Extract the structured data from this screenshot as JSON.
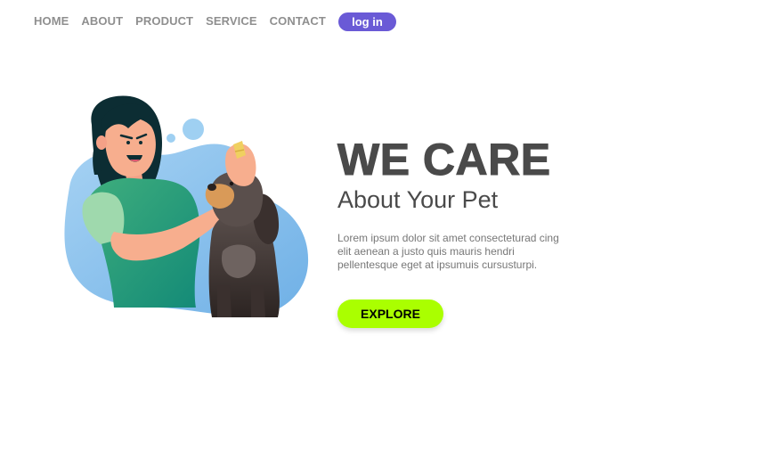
{
  "nav": {
    "items": [
      {
        "label": "HOME"
      },
      {
        "label": "ABOUT"
      },
      {
        "label": "PRODUCT"
      },
      {
        "label": "SERVICE"
      },
      {
        "label": "CONTACT"
      }
    ],
    "login_label": "log in"
  },
  "hero": {
    "title": "WE CARE",
    "subtitle": "About Your Pet",
    "description": "Lorem ipsum dolor sit amet consecteturad cing elit aenean a justo quis mauris hendri pellentesque eget at ipsumuis cursusturpi.",
    "cta_label": "EXPLORE",
    "illustration_icon": "woman-brushing-dog-illustration"
  },
  "colors": {
    "nav_text": "#8f8f8f",
    "login_bg": "#6a5ad6",
    "title_text": "#4a4a4a",
    "body_text": "#777777",
    "cta_bg": "#aaff00",
    "blob_blue": "#8cc4ee"
  }
}
